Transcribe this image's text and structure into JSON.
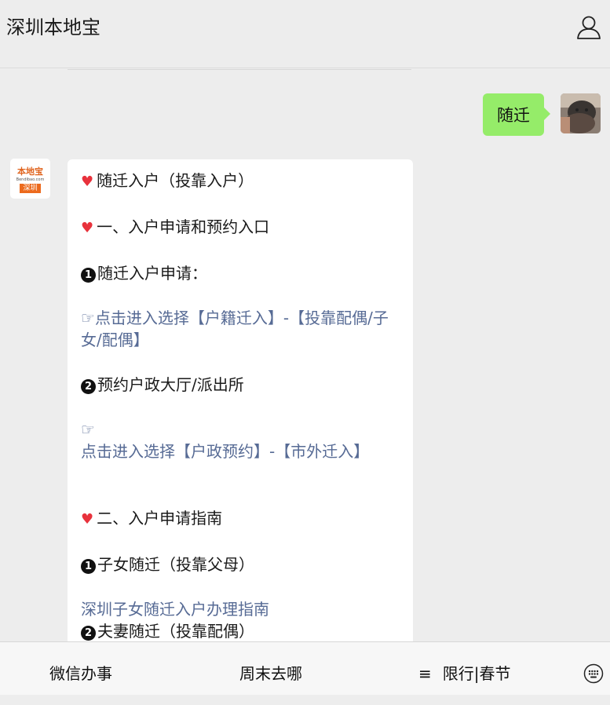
{
  "header": {
    "title": "深圳本地宝",
    "user_icon": "user-icon"
  },
  "chat": {
    "self_message": "随迁",
    "bot_avatar": {
      "logo_text": "本地宝",
      "logo_url": "Bendibao.com",
      "badge": "深圳"
    },
    "reply": {
      "line1": "随迁入户（投靠入户）",
      "section1": "一、入户申请和预约入口",
      "item1_num": "1",
      "item1": "随迁入户申请：",
      "link1_prefix": "☞",
      "link1": "点击进入选择【户籍迁入】-【投靠配偶/子女/配偶】",
      "item2_num": "2",
      "item2": "预约户政大厅/派出所",
      "link2_prefix": "☞",
      "link2": "点击进入选择【户政预约】-【市外迁入】",
      "section2": "二、入户申请指南",
      "item3_num": "1",
      "item3": "子女随迁（投靠父母）",
      "link3": "深圳子女随迁入户办理指南",
      "item4_num": "2",
      "item4": "夫妻随迁（投靠配偶）"
    }
  },
  "tabbar": {
    "tab1": "微信办事",
    "tab2": "周末去哪",
    "tab3_icon": "≡",
    "tab3": "限行|春节",
    "keyboard_icon": "keyboard-icon"
  },
  "colors": {
    "background": "#ededed",
    "self_bubble": "#95ec69",
    "link": "#576b95",
    "heart": "#e8323c"
  }
}
